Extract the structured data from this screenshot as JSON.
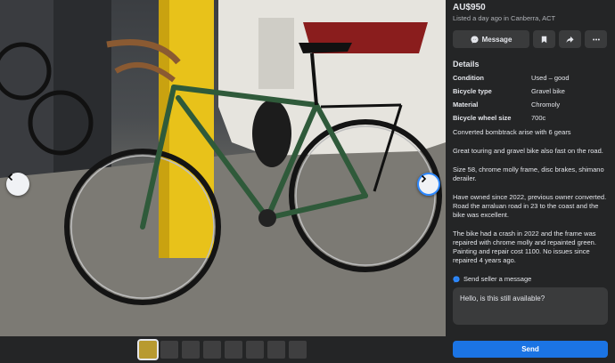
{
  "listing": {
    "price": "AU$950",
    "listed": "Listed a day ago in Canberra, ACT"
  },
  "actions": {
    "message_label": "Message",
    "icons": [
      "messenger-icon",
      "bookmark-icon",
      "share-icon",
      "more-icon"
    ]
  },
  "details": {
    "heading": "Details",
    "rows": [
      {
        "key": "Condition",
        "value": "Used – good"
      },
      {
        "key": "Bicycle type",
        "value": "Gravel bike"
      },
      {
        "key": "Material",
        "value": "Chromoly"
      },
      {
        "key": "Bicycle wheel size",
        "value": "700c"
      }
    ]
  },
  "description": [
    "Converted bombtrack arise with 6 gears",
    "Great touring and gravel bike also fast on the road.",
    "Size 58, chrome molly frame, disc brakes, shimano derailer.",
    "Have owned since 2022, previous owner converted. Road the arraluan road in 23 to the coast and the bike was excellent.",
    "The bike had a crash in 2022 and the frame was repaired with chrome molly and repainted green. Painting and repair cost 1100. No issues since repaired 4 years ago."
  ],
  "seller": {
    "label": "Send seller a message",
    "message_value": "Hello, is this still available?",
    "send_label": "Send"
  },
  "gallery": {
    "thumb_count": 8,
    "active_index": 0
  },
  "colors": {
    "panel_bg": "#242526",
    "accent": "#1b74e4",
    "frame_green": "#2f5a3a",
    "pole_yellow": "#e8c21a"
  }
}
